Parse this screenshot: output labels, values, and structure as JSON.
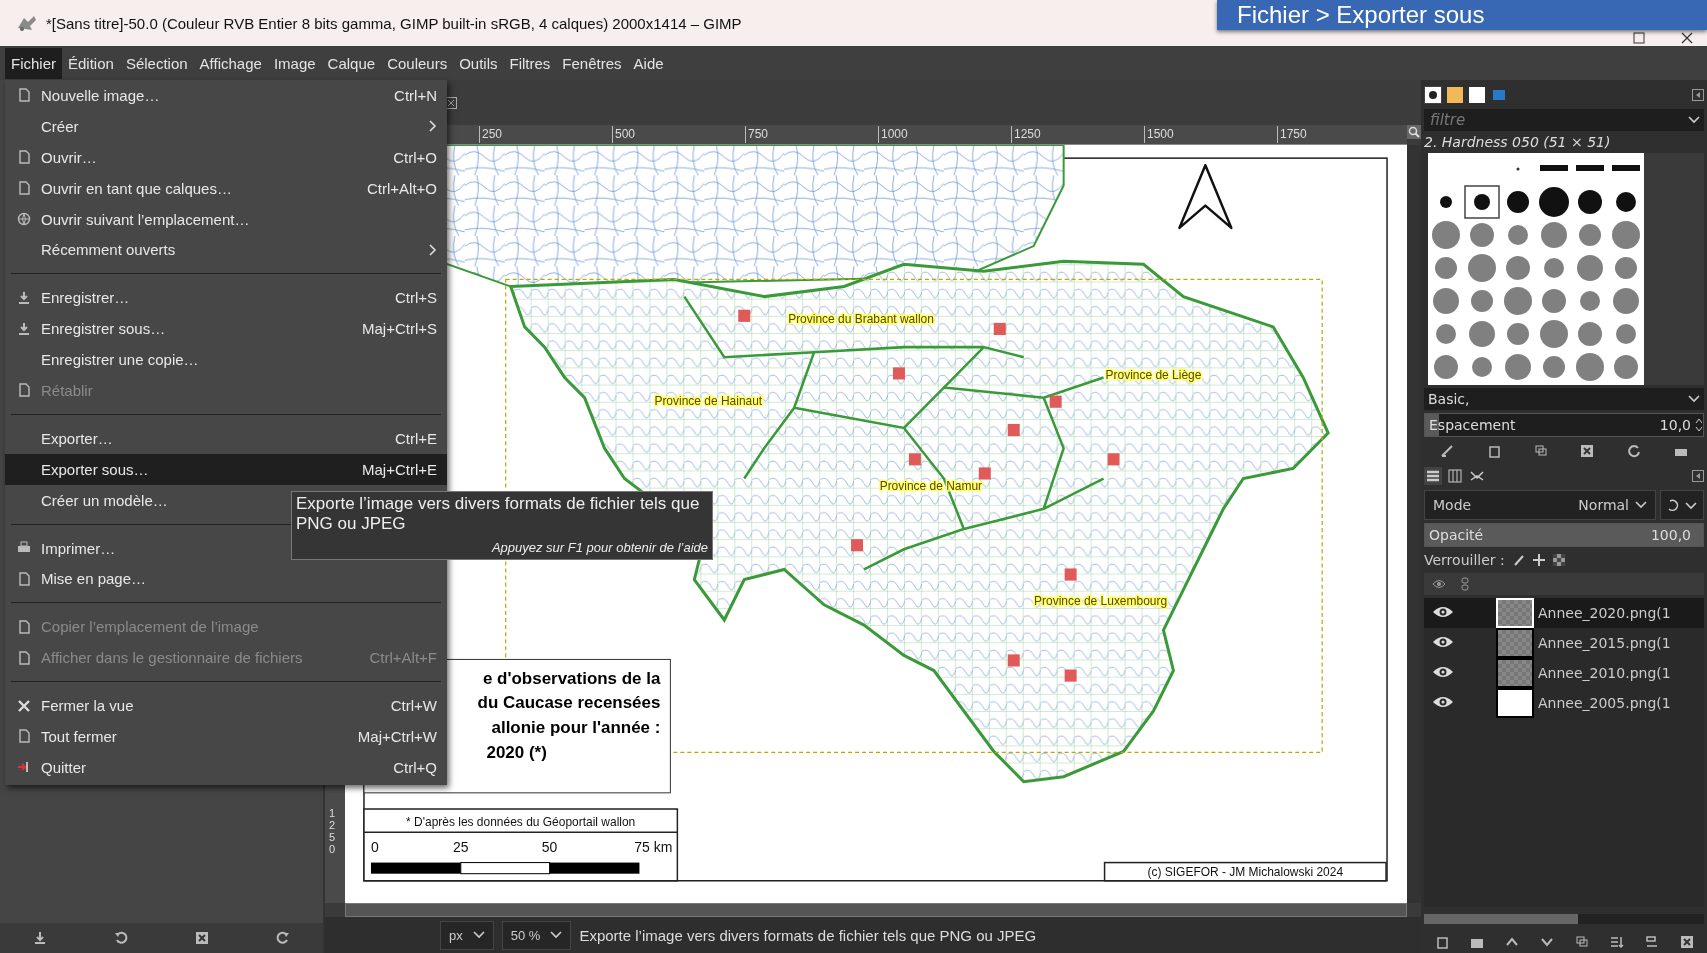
{
  "window": {
    "title": "*[Sans titre]-50.0 (Couleur RVB Entier 8 bits gamma, GIMP built-in sRGB, 4 calques) 2000x1414 – GIMP"
  },
  "callout": {
    "text": "Fichier > Exporter sous"
  },
  "menubar": [
    {
      "label": "Fichier",
      "selected": true
    },
    {
      "label": "Édition",
      "selected": false
    },
    {
      "label": "Sélection",
      "selected": false
    },
    {
      "label": "Affichage",
      "selected": false
    },
    {
      "label": "Image",
      "selected": false
    },
    {
      "label": "Calque",
      "selected": false
    },
    {
      "label": "Couleurs",
      "selected": false
    },
    {
      "label": "Outils",
      "selected": false
    },
    {
      "label": "Filtres",
      "selected": false
    },
    {
      "label": "Fenêtres",
      "selected": false
    },
    {
      "label": "Aide",
      "selected": false
    }
  ],
  "file_menu": [
    {
      "kind": "item",
      "label": "Nouvelle image…",
      "shortcut": "Ctrl+N",
      "submenu": false,
      "disabled": false,
      "selected": false
    },
    {
      "kind": "item",
      "label": "Créer",
      "submenu": true,
      "disabled": false,
      "selected": false
    },
    {
      "kind": "item",
      "label": "Ouvrir…",
      "shortcut": "Ctrl+O",
      "submenu": false,
      "disabled": false,
      "selected": false
    },
    {
      "kind": "item",
      "label": "Ouvrir en tant que calques…",
      "shortcut": "Ctrl+Alt+O",
      "submenu": false,
      "disabled": false,
      "selected": false
    },
    {
      "kind": "item",
      "label": "Ouvrir suivant l’emplacement…",
      "submenu": false,
      "disabled": false,
      "selected": false
    },
    {
      "kind": "item",
      "label": "Récemment ouverts",
      "submenu": true,
      "disabled": false,
      "selected": false
    },
    {
      "kind": "separator"
    },
    {
      "kind": "item",
      "label": "Enregistrer…",
      "shortcut": "Ctrl+S",
      "submenu": false,
      "disabled": false,
      "selected": false
    },
    {
      "kind": "item",
      "label": "Enregistrer sous…",
      "shortcut": "Maj+Ctrl+S",
      "submenu": false,
      "disabled": false,
      "selected": false
    },
    {
      "kind": "item",
      "label": "Enregistrer une copie…",
      "submenu": false,
      "disabled": false,
      "selected": false
    },
    {
      "kind": "item",
      "label": "Rétablir",
      "submenu": false,
      "disabled": true,
      "selected": false
    },
    {
      "kind": "separator"
    },
    {
      "kind": "item",
      "label": "Exporter…",
      "shortcut": "Ctrl+E",
      "submenu": false,
      "disabled": false,
      "selected": false
    },
    {
      "kind": "item",
      "label": "Exporter sous…",
      "shortcut": "Maj+Ctrl+E",
      "submenu": false,
      "disabled": false,
      "selected": true
    },
    {
      "kind": "item",
      "label": "Créer un modèle…",
      "submenu": false,
      "disabled": false,
      "selected": false
    },
    {
      "kind": "separator"
    },
    {
      "kind": "item",
      "label": "Imprimer…",
      "submenu": false,
      "disabled": false,
      "selected": false
    },
    {
      "kind": "item",
      "label": "Mise en page…",
      "submenu": false,
      "disabled": false,
      "selected": false
    },
    {
      "kind": "separator"
    },
    {
      "kind": "item",
      "label": "Copier l’emplacement de l’image",
      "submenu": false,
      "disabled": true,
      "selected": false
    },
    {
      "kind": "item",
      "label": "Afficher dans le gestionnaire de fichiers",
      "shortcut": "Ctrl+Alt+F",
      "submenu": false,
      "disabled": true,
      "selected": false
    },
    {
      "kind": "separator"
    },
    {
      "kind": "item",
      "label": "Fermer la vue",
      "shortcut": "Ctrl+W",
      "submenu": false,
      "disabled": false,
      "selected": false
    },
    {
      "kind": "item",
      "label": "Tout fermer",
      "shortcut": "Maj+Ctrl+W",
      "submenu": false,
      "disabled": false,
      "selected": false
    },
    {
      "kind": "item",
      "label": "Quitter",
      "shortcut": "Ctrl+Q",
      "submenu": false,
      "disabled": false,
      "selected": false
    }
  ],
  "tooltip": {
    "text": "Exporte l’image vers divers formats de fichier tels que PNG ou JPEG",
    "hint": "Appuyez sur F1 pour obtenir de l’aide"
  },
  "ruler": {
    "marks": [
      "250",
      "500",
      "750",
      "1000",
      "1250",
      "1500",
      "1750"
    ],
    "vertical_mark": "1250"
  },
  "map": {
    "provinces": [
      "Province du Brabant wallon",
      "Province de Hainaut",
      "Province de Liège",
      "Province de Namur",
      "Province de Luxembourg"
    ],
    "title_lines": [
      "e d'observations de la",
      "du Caucase recensées",
      "allonie pour l'année :",
      "2020 (*)"
    ],
    "source_note": "* D'après les données du Géoportail wallon",
    "scale_labels": [
      "0",
      "25",
      "50",
      "75 km"
    ],
    "credit": "(c) SIGEFOR - JM Michalowski 2024"
  },
  "status_bar": {
    "unit": "px",
    "zoom": "50 %",
    "message": "Exporte l’image vers divers formats de fichier tels que PNG ou JPEG"
  },
  "brushes": {
    "filter_placeholder": "filtre",
    "selected_brush": "2. Hardness 050 (51 × 51)",
    "tag": "Basic,",
    "spacing": {
      "label": "Espacement",
      "value": "10,0",
      "level": 0.05
    }
  },
  "layers": {
    "mode_label": "Mode",
    "mode": "Normal",
    "opacity": {
      "label": "Opacité",
      "value": "100,0",
      "level": 1
    },
    "lock_label": "Verrouiller :",
    "items": [
      {
        "name": "Annee_2020.png(1",
        "visible": true,
        "selected": true
      },
      {
        "name": "Annee_2015.png(1",
        "visible": true,
        "selected": false
      },
      {
        "name": "Annee_2010.png(1",
        "visible": true,
        "selected": false
      },
      {
        "name": "Annee_2005.png(1",
        "visible": true,
        "selected": false
      }
    ]
  }
}
